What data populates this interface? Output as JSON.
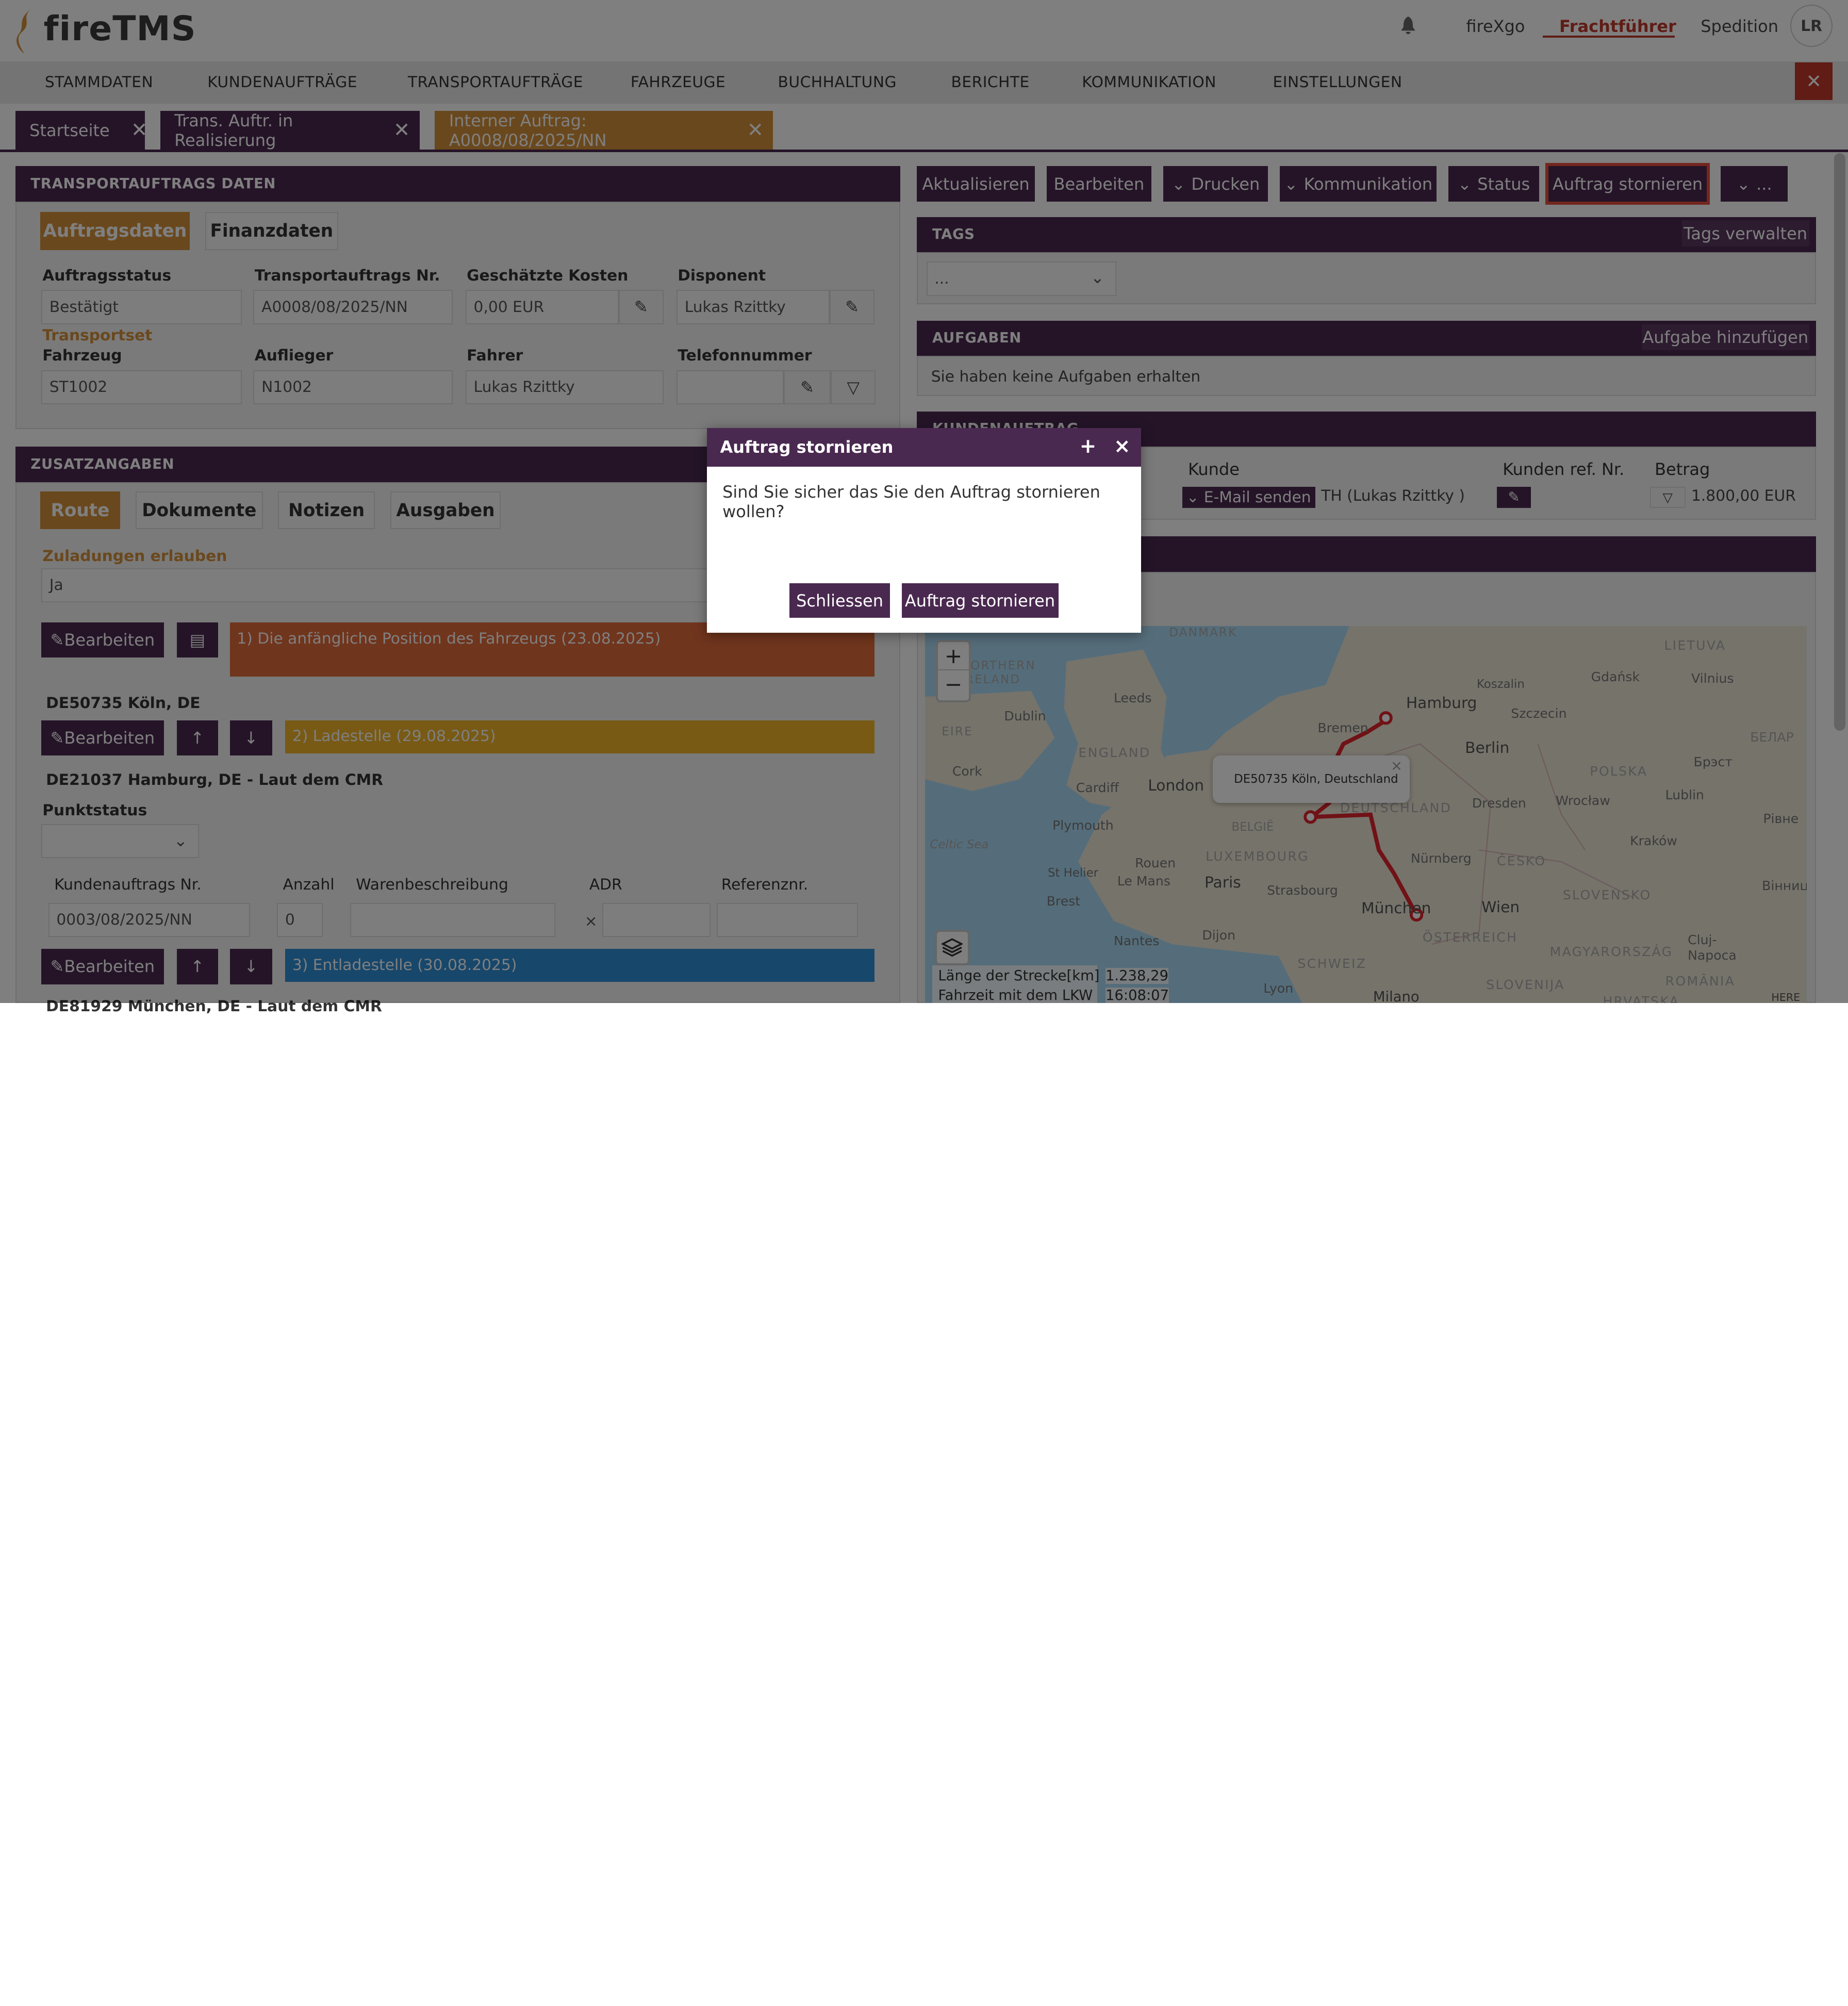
{
  "app": {
    "logo_text": "fireTMS"
  },
  "user": {
    "links": [
      "fireXgo",
      "Frachtführer",
      "Spedition"
    ],
    "active_link": "Frachtführer",
    "avatar": "LR"
  },
  "menu": [
    "STAMMDATEN",
    "KUNDENAUFTRÄGE",
    "TRANSPORTAUFTRÄGE",
    "FAHRZEUGE",
    "BUCHHALTUNG",
    "BERICHTE",
    "KOMMUNIKATION",
    "EINSTELLUNGEN"
  ],
  "tabs": [
    {
      "label": "Startseite"
    },
    {
      "label": "Trans. Auftr. in Realisierung"
    },
    {
      "label": "Interner Auftrag: A0008/08/2025/NN"
    }
  ],
  "transport": {
    "title": "TRANSPORTAUFTRAGS DATEN",
    "subtabs": [
      "Auftragsdaten",
      "Finanzdaten"
    ],
    "auftragsstatus_label": "Auftragsstatus",
    "auftragsstatus": "Bestätigt",
    "nr_label": "Transportauftrags Nr.",
    "nr": "A0008/08/2025/NN",
    "kosten_label": "Geschätzte Kosten",
    "kosten": "0,00 EUR",
    "disponent_label": "Disponent",
    "disponent": "Lukas Rzittky",
    "transportset_label": "Transportset",
    "fahrzeug_label": "Fahrzeug",
    "fahrzeug": "ST1002",
    "auflieger_label": "Auflieger",
    "auflieger": "N1002",
    "fahrer_label": "Fahrer",
    "fahrer": "Lukas Rzittky",
    "telefon_label": "Telefonnummer",
    "telefon": ""
  },
  "zusatz": {
    "title": "ZUSATZANGABEN",
    "subtabs": [
      "Route",
      "Dokumente",
      "Notizen",
      "Ausgaben"
    ],
    "zuladungen_label": "Zuladungen erlauben",
    "zuladungen": "Ja",
    "bearbeiten": "Bearbeiten",
    "step1": "1) Die anfängliche Position des Fahrzeugs (23.08.2025)",
    "loc1": "DE50735 Köln, DE",
    "step2": "2) Ladestelle (29.08.2025)",
    "loc2": "DE21037 Hamburg, DE - Laut dem CMR",
    "punktstatus_label": "Punktstatus",
    "table_headers": [
      "Kundenauftrags Nr.",
      "Anzahl",
      "Warenbeschreibung",
      "ADR",
      "Referenznr."
    ],
    "row": {
      "nr": "0003/08/2025/NN",
      "anzahl": "0"
    },
    "adr_mark": "×",
    "step3": "3) Entladestelle (30.08.2025)",
    "loc3_partial": "DE81929 München, DE - Laut dem CMR"
  },
  "actions": [
    "Aktualisieren",
    "Bearbeiten",
    "Drucken",
    "Kommunikation",
    "Status",
    "Auftrag stornieren",
    "..."
  ],
  "tags": {
    "title": "TAGS",
    "manage": "Tags verwalten",
    "select": "..."
  },
  "aufgaben": {
    "title": "AUFGABEN",
    "add": "Aufgabe hinzufügen",
    "empty": "Sie haben keine Aufgaben erhalten"
  },
  "kunden": {
    "title": "KUNDENAUFTRAG",
    "headers": [
      "Kunde",
      "Kunden ref. Nr.",
      "Betrag"
    ],
    "email_btn": "E-Mail senden",
    "kunde": "TH (Lukas Rzittky )",
    "betrag": "1.800,00 EUR"
  },
  "map": {
    "popup": "DE50735 Köln, Deutschland",
    "labels": [
      "DANMARK",
      "LIETUVA",
      "Gdańsk",
      "Vilnius",
      "Koszalin",
      "NORTHERN IRELAND",
      "Hamburg",
      "Bremen",
      "Szczecin",
      "Leeds",
      "Dublin",
      "EIRE",
      "Berlin",
      "ENGLAND",
      "БЕЛАР",
      "Cork",
      "Cardiff",
      "London",
      "POLSKA",
      "Брэст",
      "Dresden",
      "Wrocław",
      "Lublin",
      "Plymouth",
      "BELGIË",
      "DEUTSCHLAND",
      "Рівне",
      "Celtic Sea",
      "LUXEMBOURG",
      "Kraków",
      "St Helier",
      "Paris",
      "Strasbourg",
      "Nürnberg",
      "ČESKO",
      "Rouen",
      "Brest",
      "Le Mans",
      "München",
      "Wien",
      "SLOVENSKO",
      "Вінниц",
      "Nantes",
      "Dijon",
      "ÖSTERREICH",
      "MAGYARORSZÁG",
      "Cluj-Napoca",
      "SCHWEIZ",
      "SLOVENIJA",
      "ROMÂNIA",
      "Lyon",
      "Milano",
      "HRVATSKA"
    ],
    "zoom_in": "+",
    "zoom_out": "−",
    "length_label": "Länge der Strecke[km]",
    "length": "1.238,29",
    "time_label": "Fahrzeit mit dem LKW",
    "time": "16:08:07",
    "credit": "HERE"
  },
  "modal": {
    "title": "Auftrag stornieren",
    "plus": "+",
    "close": "×",
    "message": "Sind Sie sicher das Sie den Auftrag stornieren wollen?",
    "btn_close": "Schliessen",
    "btn_confirm": "Auftrag stornieren"
  },
  "colors": {
    "primary": "#4a2950",
    "accent": "#d4913a",
    "danger": "#e74c3c",
    "step1": "#e06a3a",
    "step2": "#f0b52a",
    "step3": "#2f8fd6"
  }
}
